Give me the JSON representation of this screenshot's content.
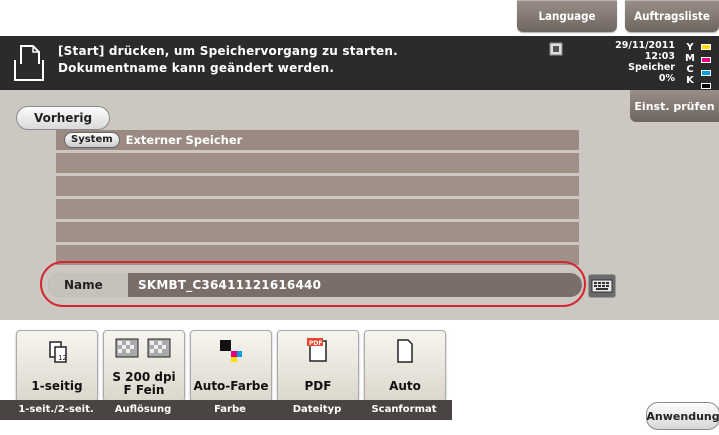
{
  "top_buttons": {
    "language": "Language",
    "job_list": "Auftragsliste"
  },
  "message": {
    "line1": "[Start] drücken, um Speichervorgang zu starten.",
    "line2": "Dokumentname kann geändert werden."
  },
  "status": {
    "date": "29/11/2011",
    "time": "12:03",
    "memory_label": "Speicher",
    "memory_value": "0%",
    "toner_labels": [
      "Y",
      "M",
      "C",
      "K"
    ],
    "toner_colors": [
      "#ffe000",
      "#e4007f",
      "#00a0e9",
      "#000000"
    ]
  },
  "nav": {
    "back": "Vorherig",
    "check_settings": "Einst. prüfen"
  },
  "list": {
    "badge": "System",
    "first_row": "Externer Speicher",
    "empty_rows": 5
  },
  "name_field": {
    "label": "Name",
    "value": "SKMBT_C36411121616440"
  },
  "functions": [
    {
      "label": "1-seitig",
      "caption": "1-seit./2-seit.",
      "icon": "simplex-icon"
    },
    {
      "label_line1": "S 200 dpi",
      "label_line2": "F Fein",
      "caption": "Auflösung",
      "icon": "resolution-icon"
    },
    {
      "label": "Auto-Farbe",
      "caption": "Farbe",
      "icon": "color-icon"
    },
    {
      "label": "PDF",
      "caption": "Dateityp",
      "icon": "pdf-icon"
    },
    {
      "label": "Auto",
      "caption": "Scanformat",
      "icon": "page-icon"
    }
  ],
  "apply_button": "Anwendung"
}
